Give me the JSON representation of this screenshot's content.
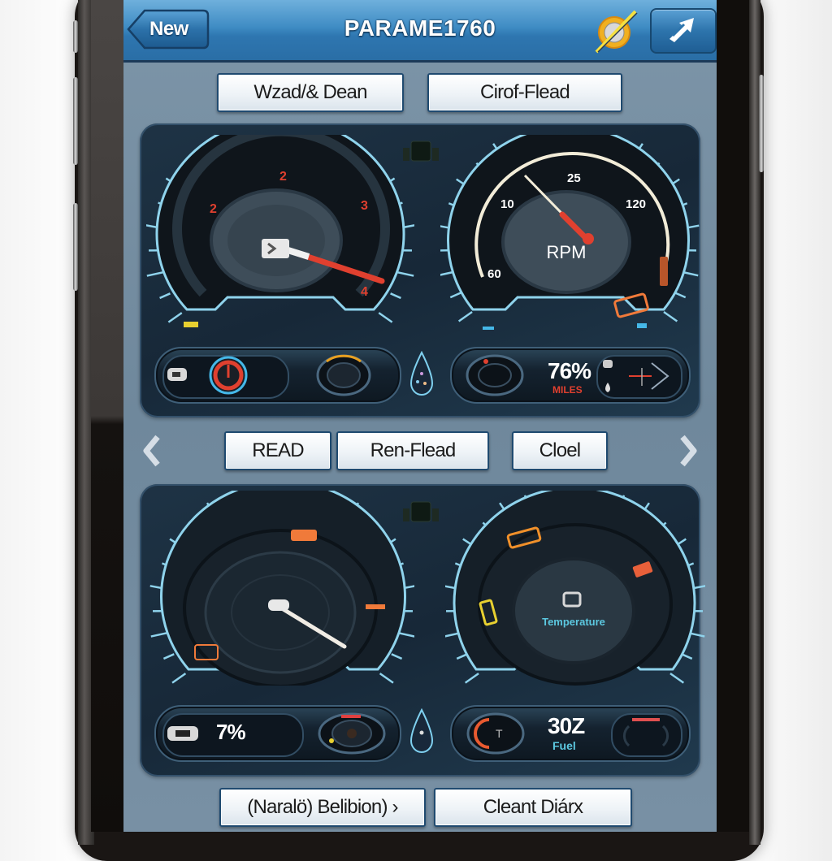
{
  "header": {
    "back_label": "New",
    "title": "PARAME1760",
    "sync_icon": "sync-disabled-icon",
    "share_icon": "share-arrow-icon"
  },
  "top_buttons": [
    {
      "label": "Wzad/& Dean"
    },
    {
      "label": "Cirof-Flead"
    }
  ],
  "panel_top": {
    "left_gauge": {
      "type": "gauge",
      "tick_labels": [
        "2",
        "2",
        "3",
        "4"
      ],
      "needle_icon": "wrench-icon",
      "accent": "#e0402f"
    },
    "right_gauge": {
      "type": "tachometer",
      "label": "RPM",
      "tick_labels": [
        "60",
        "10",
        "25",
        "120"
      ],
      "accent": "#e0402f"
    },
    "left_readout": {
      "icons": [
        "battery-icon",
        "temperature-dial-icon",
        "camera-lens-icon"
      ]
    },
    "right_readout": {
      "value": "76%",
      "sublabel": "MILES",
      "icons": [
        "camera-lens-icon",
        "oil-icon",
        "compass-icon"
      ]
    }
  },
  "middle_nav": {
    "prev_icon": "chevron-left-icon",
    "next_icon": "chevron-right-icon",
    "buttons": [
      {
        "label": "READ"
      },
      {
        "label": "Ren-Flead"
      },
      {
        "label": "Cloel"
      }
    ]
  },
  "panel_bottom": {
    "left_gauge": {
      "type": "gauge",
      "needle_icon": "needle-icon"
    },
    "right_gauge": {
      "type": "gauge",
      "label": "Temperature",
      "center_icon": "engine-icon"
    },
    "left_readout": {
      "value": "7%",
      "icons": [
        "battery-icon",
        "camera-lens-icon"
      ]
    },
    "right_readout": {
      "value": "30Z",
      "sublabel": "Fuel",
      "icons": [
        "fuel-dial-icon",
        "lens-icon"
      ]
    }
  },
  "bottom_buttons": [
    {
      "label": "(Naralö) Belibion) ›"
    },
    {
      "label": "Cleant Diárx"
    }
  ],
  "colors": {
    "topbar": "#2e76b0",
    "panel": "#172838",
    "gauge_ring": "#8fd3ec",
    "needle_red": "#e0402f",
    "warning_orange": "#f07a3a",
    "warning_yellow": "#e8d030",
    "teal_label": "#5cc8e0"
  }
}
